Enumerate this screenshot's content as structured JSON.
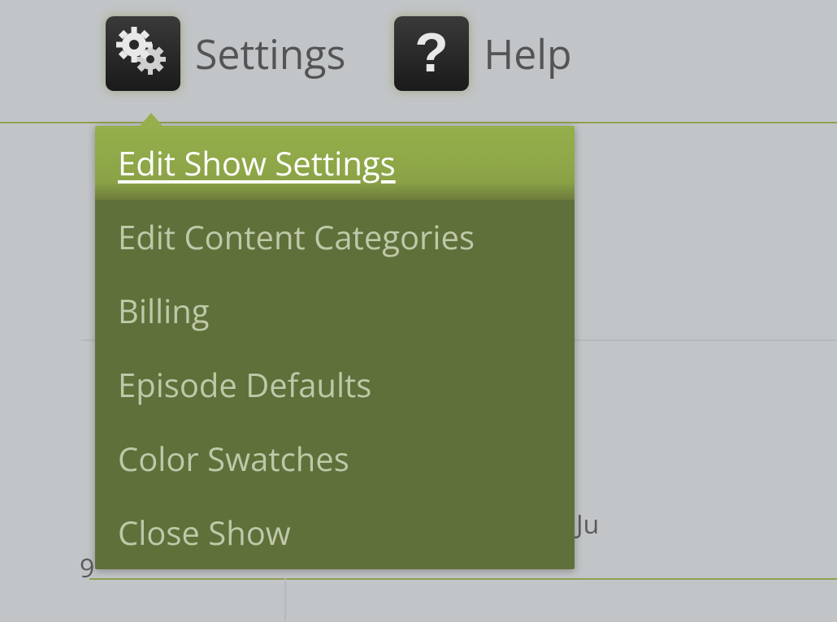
{
  "toolbar": {
    "settings_label": "Settings",
    "help_label": "Help"
  },
  "dropdown": {
    "items": [
      {
        "label": "Edit Show Settings",
        "active": true
      },
      {
        "label": "Edit Content Categories",
        "active": false
      },
      {
        "label": "Billing",
        "active": false
      },
      {
        "label": "Episode Defaults",
        "active": false
      },
      {
        "label": "Color Swatches",
        "active": false
      },
      {
        "label": "Close Show",
        "active": false
      }
    ]
  },
  "calendar": {
    "row_label_1": "9",
    "col_label_1": "Ju"
  }
}
